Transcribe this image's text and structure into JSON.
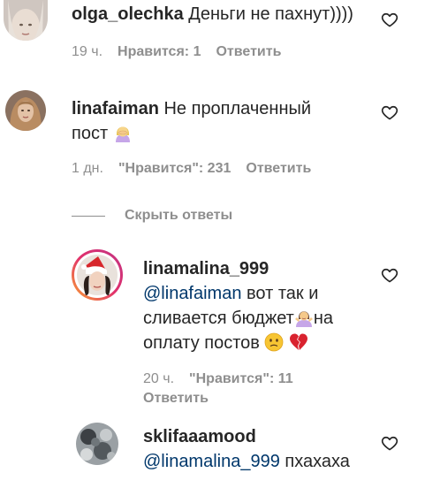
{
  "comments": [
    {
      "username": "olga_olechka",
      "text": "Деньги не пахнут))))",
      "time": "19 ч.",
      "likes": "Нравится: 1",
      "reply": "Ответить"
    },
    {
      "username": "linafaiman",
      "text_line1": "Не проплаченный",
      "text_line2": "пост",
      "time": "1 дн.",
      "likes": "\"Нравится\": 231",
      "reply": "Ответить"
    }
  ],
  "hide_replies": "Скрыть ответы",
  "replies": [
    {
      "username": "linamalina_999",
      "mention": "@linafaiman",
      "text_a": " вот так и",
      "text_b": "сливается бюджет",
      "text_c": "на",
      "text_d": "оплату постов ",
      "time": "20 ч.",
      "likes": "\"Нравится\": 11",
      "reply": "Ответить"
    },
    {
      "username": "sklifaaamood",
      "mention": "@linamalina_999",
      "text": " пхахаха"
    }
  ],
  "icons": {
    "like": "heart-outline-icon",
    "emoji_1": "woman-facepalming-emoji",
    "emoji_2": "woman-shrugging-emoji",
    "emoji_3": "confused-face-emoji",
    "emoji_4": "broken-heart-emoji"
  },
  "colors": {
    "text": "#262626",
    "meta": "#8e8e8e",
    "mention": "#00376b"
  }
}
